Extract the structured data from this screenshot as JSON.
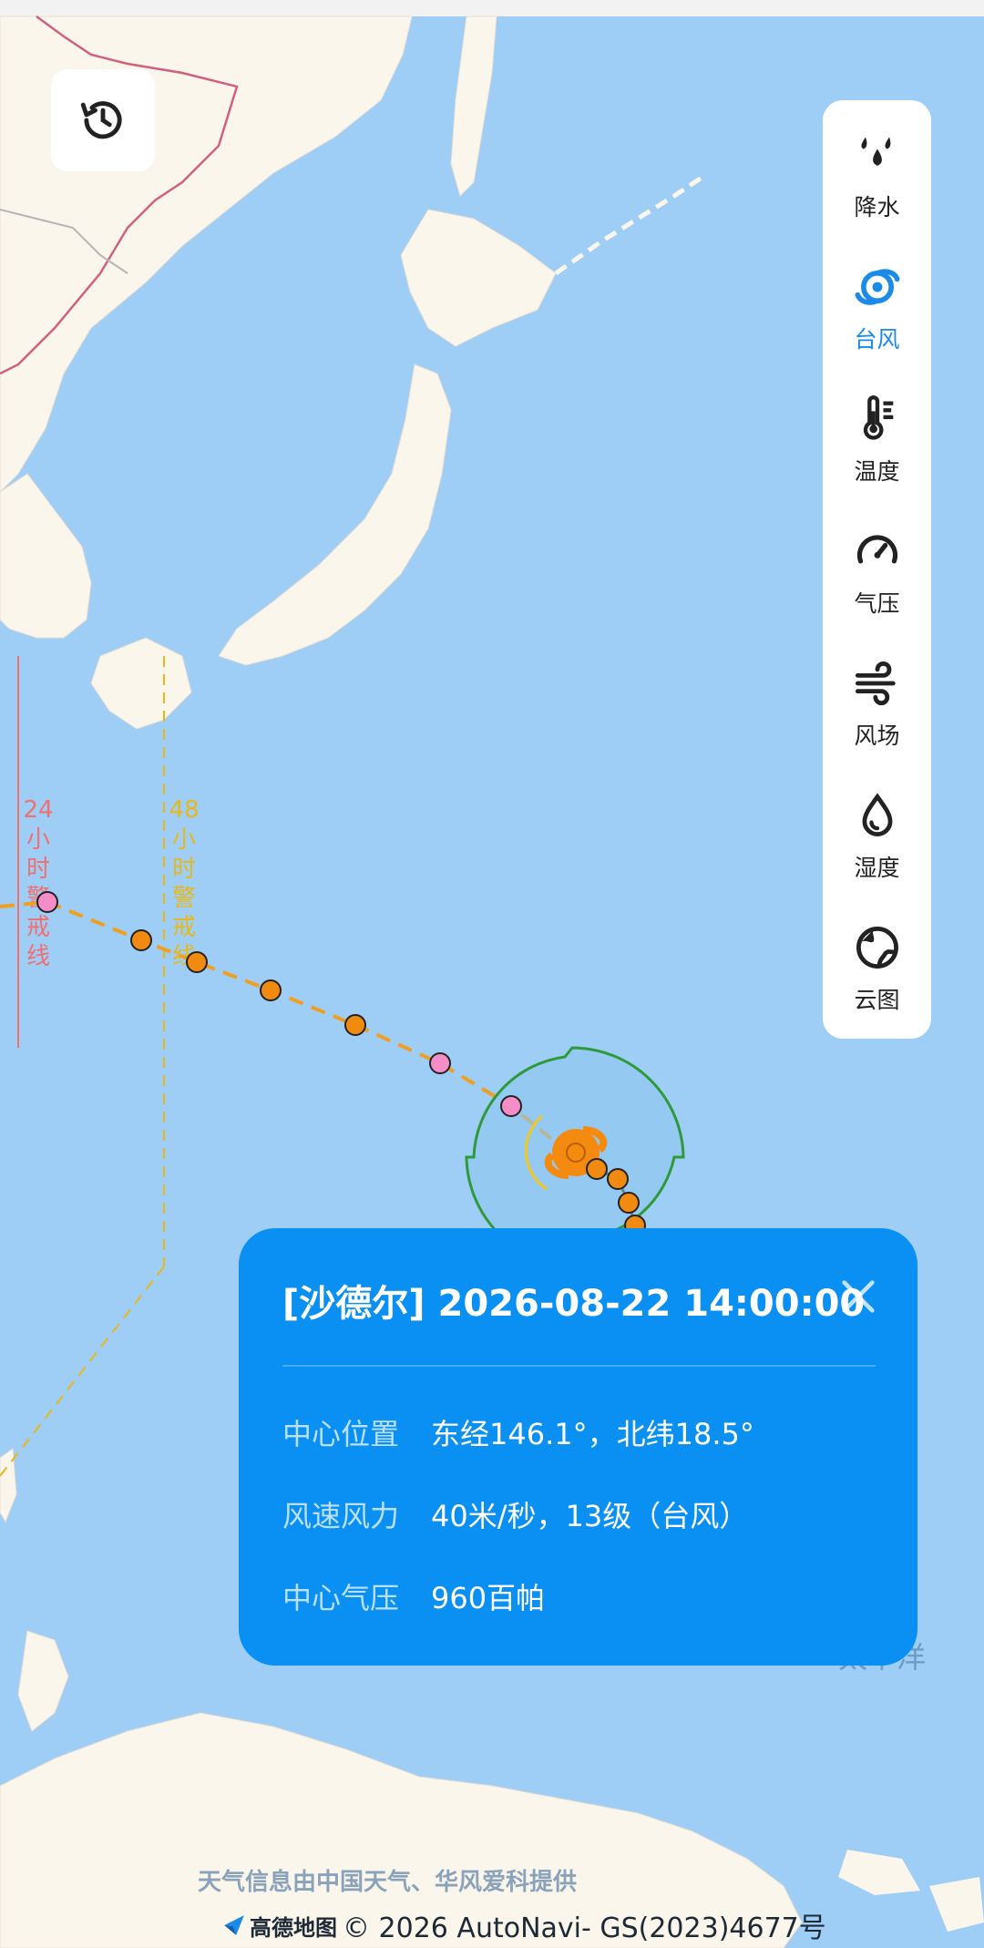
{
  "warning_lines": {
    "line24": {
      "label": [
        "24",
        "小",
        "时",
        "警",
        "戒",
        "线"
      ],
      "color": "#f07070"
    },
    "line48": {
      "label": [
        "48",
        "小",
        "时",
        "警",
        "戒",
        "线"
      ],
      "color": "#e8b81a"
    }
  },
  "map_labels": {
    "ocean": "太平洋"
  },
  "history_button": {
    "icon": "history-clock-icon"
  },
  "layers": [
    {
      "label": "降水",
      "icon": "rain-drops-icon",
      "active": false
    },
    {
      "label": "台风",
      "icon": "typhoon-icon",
      "active": true
    },
    {
      "label": "温度",
      "icon": "thermometer-icon",
      "active": false
    },
    {
      "label": "气压",
      "icon": "gauge-icon",
      "active": false
    },
    {
      "label": "风场",
      "icon": "wind-icon",
      "active": false
    },
    {
      "label": "湿度",
      "icon": "humidity-drop-icon",
      "active": false
    },
    {
      "label": "云图",
      "icon": "globe-cloud-icon",
      "active": false
    }
  ],
  "typhoon": {
    "title": "[沙德尔] 2026-08-22 14:00:00",
    "rows": [
      {
        "key": "中心位置",
        "value": "东经146.1°，北纬18.5°"
      },
      {
        "key": "风速风力",
        "value": "40米/秒，13级（台风）"
      },
      {
        "key": "中心气压",
        "value": "960百帕"
      }
    ]
  },
  "footer": {
    "credit": "天气信息由中国天气、华风爱科提供",
    "brand": "高德地图",
    "copyright": "© 2026 AutoNavi- GS(2023)4677号"
  },
  "colors": {
    "ocean": "#9ecdf6",
    "land": "#fbf6ec",
    "card": "#0a8ff2",
    "active": "#1a8be8",
    "track": "#f0a020",
    "forecast_point": "#f08a10",
    "past_point": "#f58ec8",
    "wind_circle": "#2e9a3a"
  }
}
